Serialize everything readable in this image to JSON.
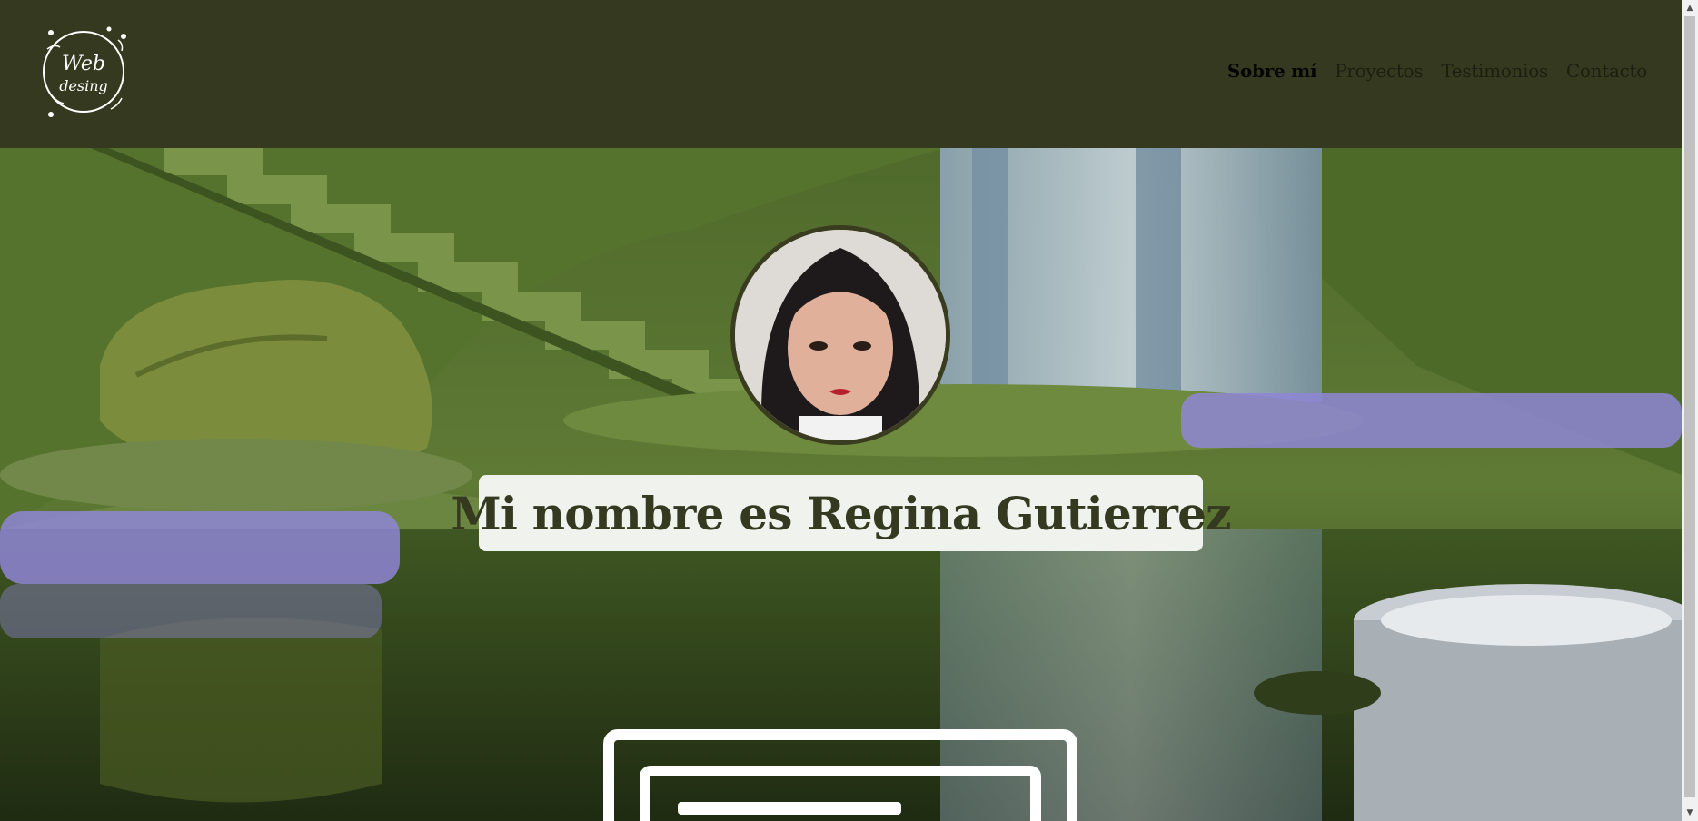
{
  "logo": {
    "line1": "Web",
    "line2": "desing"
  },
  "nav": {
    "items": [
      {
        "label": "Sobre mí",
        "active": true
      },
      {
        "label": "Proyectos",
        "active": false
      },
      {
        "label": "Testimonios",
        "active": false
      },
      {
        "label": "Contacto",
        "active": false
      }
    ]
  },
  "hero": {
    "title": "Mi nombre es Regina Gutierrez"
  },
  "colors": {
    "header_bg": "#35391f",
    "title_bg": "#eff2ed",
    "title_text": "#35391f"
  }
}
